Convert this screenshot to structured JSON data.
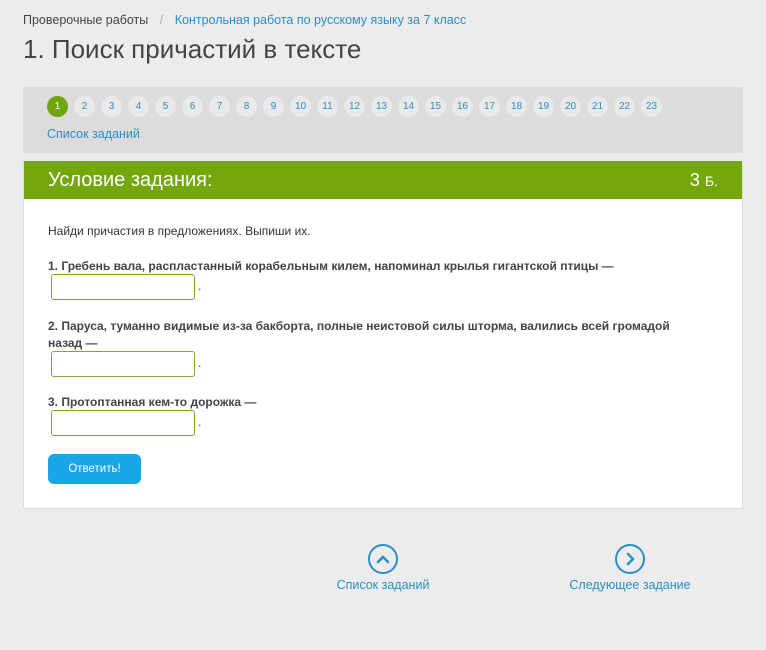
{
  "breadcrumb": {
    "home": "Проверочные работы",
    "separator": "/",
    "current": "Контрольная работа по русскому языку за 7 класс"
  },
  "page_title": "1. Поиск причастий в тексте",
  "task_nav": {
    "active": 1,
    "numbers": [
      "1",
      "2",
      "3",
      "4",
      "5",
      "6",
      "7",
      "8",
      "9",
      "10",
      "11",
      "12",
      "13",
      "14",
      "15",
      "16",
      "17",
      "18",
      "19",
      "20",
      "21",
      "22",
      "23"
    ],
    "list_link": "Список заданий"
  },
  "card": {
    "header_title": "Условие задания:",
    "points_value": "3",
    "points_unit": "Б.",
    "instruction": "Найди причастия в предложениях. Выпиши их.",
    "questions": [
      {
        "text": "1. Гребень вала, распластанный корабельным килем, напоминал крылья гигантской птицы —",
        "value": "",
        "suffix": "."
      },
      {
        "text": "2. Паруса, туманно видимые из-за бакборта, полные неистовой силы шторма, валились всей громадой назад —",
        "value": "",
        "suffix": "."
      },
      {
        "text": "3. Протоптанная кем-то дорожка —",
        "value": "",
        "suffix": "."
      }
    ],
    "submit_label": "Ответить!"
  },
  "bottom_nav": {
    "list_label": "Список заданий",
    "next_label": "Следующее задание"
  },
  "colors": {
    "accent_green": "#73a70b",
    "link_blue": "#2a8fc7",
    "button_blue": "#1aa6e6"
  },
  "icons": {
    "list": "chevron-up-icon",
    "next": "chevron-right-icon"
  }
}
